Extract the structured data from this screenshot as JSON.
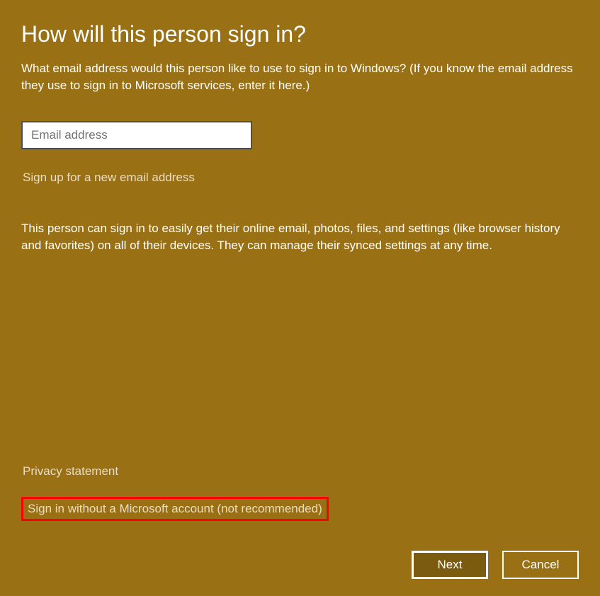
{
  "title": "How will this person sign in?",
  "description": "What email address would this person like to use to sign in to Windows? (If you know the email address they use to sign in to Microsoft services, enter it here.)",
  "email": {
    "placeholder": "Email address",
    "value": ""
  },
  "signup_link": "Sign up for a new email address",
  "info_text": "This person can sign in to easily get their online email, photos, files, and settings (like browser history and favorites) on all of their devices. They can manage their synced settings at any time.",
  "privacy_link": "Privacy statement",
  "no_account_link": "Sign in without a Microsoft account (not recommended)",
  "buttons": {
    "next": "Next",
    "cancel": "Cancel"
  }
}
